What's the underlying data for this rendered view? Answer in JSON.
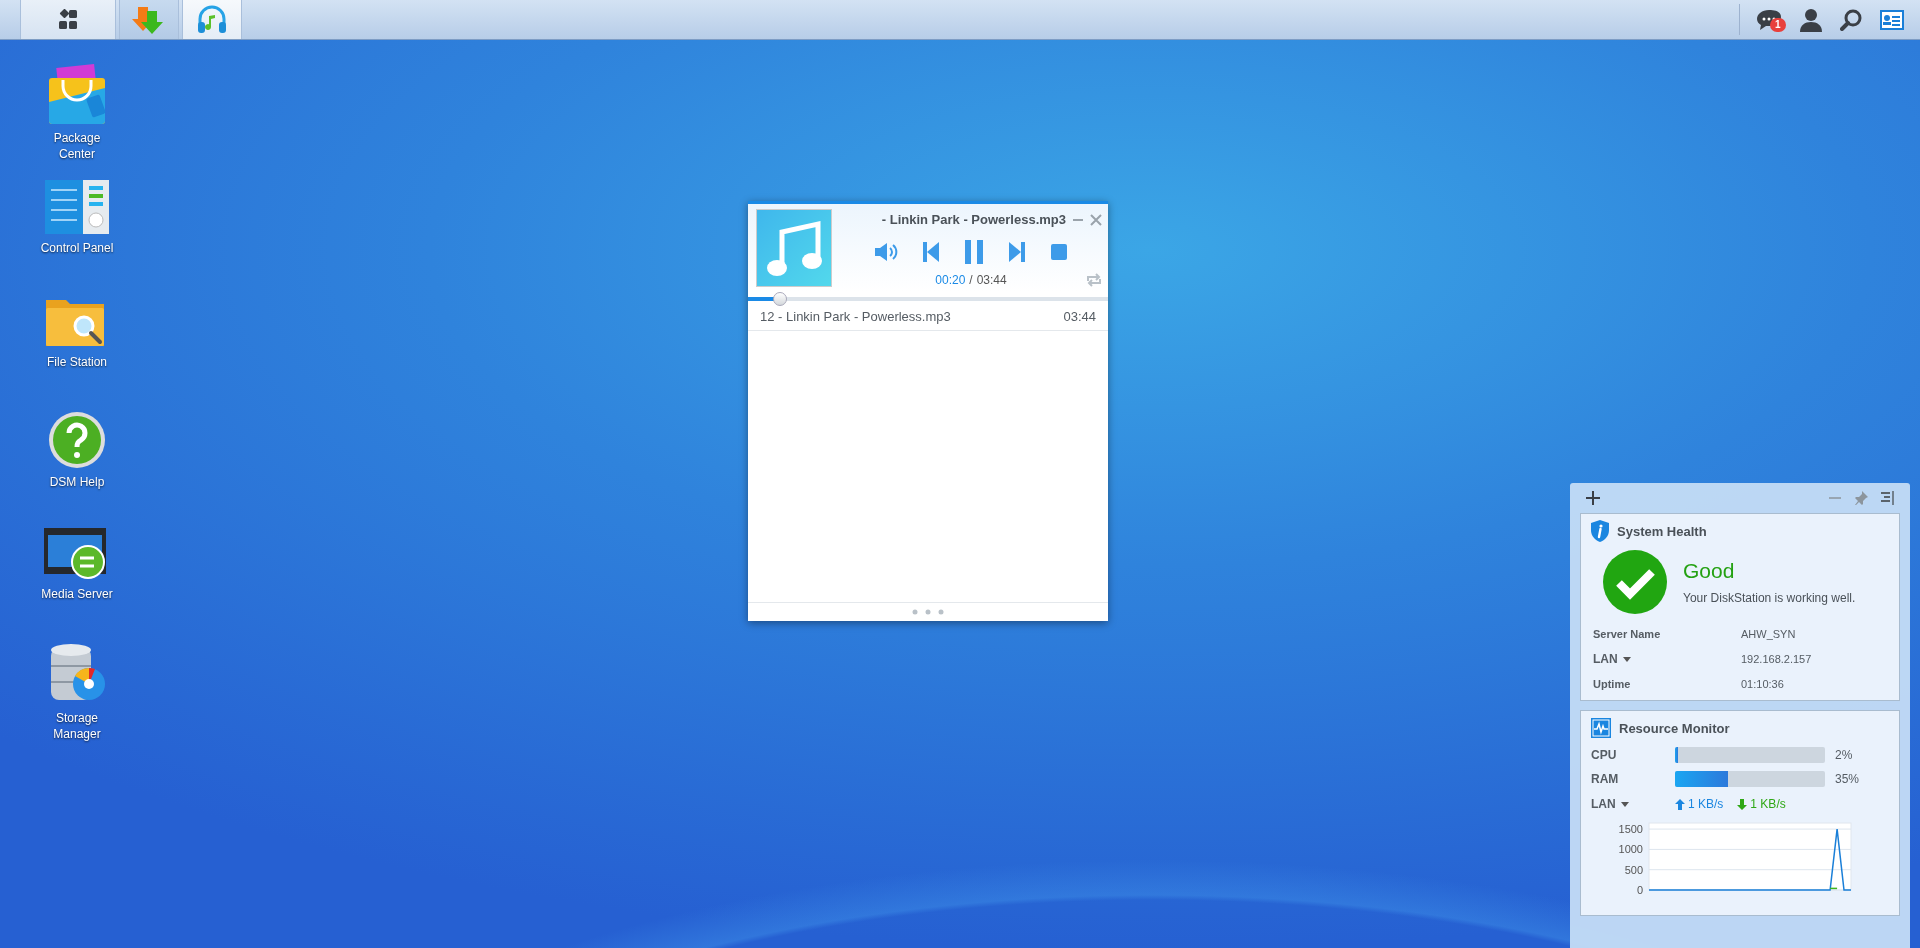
{
  "taskbar": {
    "apps": [
      {
        "kind": "main-menu",
        "selected": false
      },
      {
        "kind": "download",
        "selected": false
      },
      {
        "kind": "audio",
        "selected": true
      }
    ],
    "notification_count": "1"
  },
  "desktop_icons": [
    {
      "kind": "package",
      "label": "Package Center"
    },
    {
      "kind": "control",
      "label": "Control Panel"
    },
    {
      "kind": "folder",
      "label": "File Station"
    },
    {
      "kind": "help",
      "label": "DSM Help"
    },
    {
      "kind": "media",
      "label": "Media Server"
    },
    {
      "kind": "storage",
      "label": "Storage Manager"
    }
  ],
  "player": {
    "title": "- Linkin Park - Powerless.mp3",
    "playing": true,
    "elapsed": "00:20",
    "separator": "/",
    "total": "03:44",
    "progress": {
      "level": 0.09
    },
    "playlist": [
      {
        "title": "12 - Linkin Park - Powerless.mp3",
        "duration": "03:44"
      }
    ]
  },
  "widgets": {
    "system_health": {
      "title": "System Health",
      "status": "Good",
      "message": "Your DiskStation is working well.",
      "rows": [
        {
          "label": "Server Name",
          "value": "AHW_SYN",
          "dropdown": false
        },
        {
          "label": "LAN",
          "value": "192.168.2.157",
          "dropdown": true
        },
        {
          "label": "Uptime",
          "value": "01:10:36",
          "dropdown": false
        }
      ]
    },
    "resource_monitor": {
      "title": "Resource Monitor",
      "meters": [
        {
          "name": "CPU",
          "level": 0.02,
          "reading": "2%"
        },
        {
          "name": "RAM",
          "level": 0.35,
          "reading": "35%"
        }
      ],
      "network": {
        "label": "LAN",
        "dropdown": true,
        "upload": "1 KB/s",
        "download": "1 KB/s"
      },
      "chart_data": {
        "type": "line",
        "grid": true,
        "ylim": [
          0,
          1650
        ],
        "yticks": [
          0,
          500,
          1000,
          1500
        ],
        "series": [
          {
            "color": "#1a7fd8",
            "values": [
              0,
              0,
              0,
              0,
              0,
              0,
              0,
              0,
              0,
              0,
              0,
              0,
              0,
              0,
              0,
              0,
              0,
              0,
              0,
              0,
              0,
              0,
              0,
              0,
              0,
              0,
              0,
              1500,
              0,
              0
            ]
          },
          {
            "color": "#3db51e",
            "values": [
              null,
              null,
              null,
              null,
              null,
              null,
              null,
              null,
              null,
              null,
              null,
              null,
              null,
              null,
              null,
              null,
              null,
              null,
              null,
              null,
              null,
              null,
              null,
              null,
              null,
              null,
              40,
              40,
              null,
              null
            ]
          }
        ]
      }
    }
  }
}
